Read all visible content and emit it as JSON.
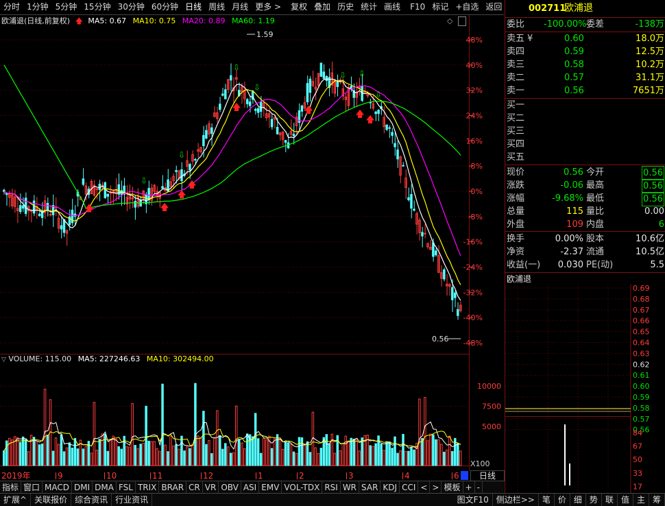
{
  "toolbar": {
    "items": [
      "分时",
      "1分钟",
      "5分钟",
      "15分钟",
      "30分钟",
      "60分钟",
      "日线",
      "周线",
      "月线",
      "更多 >",
      "复权",
      "叠加",
      "历史",
      "统计",
      "画线",
      "F10",
      "标记",
      "+自选",
      "返回"
    ],
    "active": "日线"
  },
  "legend": {
    "title": "欧浦退(日线,前复权)",
    "ma5": "MA5: 0.67",
    "ma10": "MA10: 0.75",
    "ma20": "MA20: 0.89",
    "ma60": "MA60: 1.19",
    "colors": {
      "ma5": "#ffffff",
      "ma10": "#ffff00",
      "ma20": "#ff00ff",
      "ma60": "#00ff00"
    }
  },
  "price_axis": [
    "48%",
    "40%",
    "32%",
    "24%",
    "16%",
    "8%",
    "0%",
    "-8%",
    "-16%",
    "-24%",
    "-32%",
    "-40%",
    "-48%"
  ],
  "annotations": {
    "high": "1.59",
    "low_marker": "0.56"
  },
  "volume": {
    "legend_vol": "VOLUME: 115.00",
    "legend_ma5": "MA5: 227246.63",
    "legend_ma10": "MA10: 302494.00",
    "axis": [
      "10000",
      "7500",
      "5000"
    ],
    "unit": "X100"
  },
  "dates": [
    "2019年",
    "9",
    "10",
    "11",
    "12",
    "1",
    "2",
    "3",
    "4",
    "6"
  ],
  "side_period_btn": "日线",
  "chart_data": {
    "type": "candlestick",
    "title": "欧浦退(日线,前复权)",
    "series_names": [
      "MA5",
      "MA10",
      "MA20",
      "MA60"
    ],
    "y_axis_labels": [
      "48%",
      "40%",
      "32%",
      "24%",
      "16%",
      "8%",
      "0%",
      "-8%",
      "-16%",
      "-24%",
      "-32%",
      "-40%",
      "-48%"
    ],
    "ylim_pct": [
      -52,
      52
    ],
    "annotated_high": 1.59,
    "last_close": 0.56,
    "ma_values_latest": {
      "MA5": 0.67,
      "MA10": 0.75,
      "MA20": 0.89,
      "MA60": 1.19
    },
    "volume_axis": [
      10000,
      7500,
      5000
    ],
    "volume_latest": 115.0,
    "volume_ma5": 227246.63,
    "volume_ma10": 302494.0
  },
  "quote": {
    "code": "002711",
    "name": "欧浦退",
    "weibi_label": "委比",
    "weibi": "-100.00%",
    "weicha_label": "委差",
    "weicha": "-138万",
    "asks": [
      {
        "label": "卖五",
        "mark": "¥",
        "price": "0.60",
        "vol": "18.0万"
      },
      {
        "label": "卖四",
        "mark": "",
        "price": "0.59",
        "vol": "12.5万"
      },
      {
        "label": "卖三",
        "mark": "",
        "price": "0.58",
        "vol": "10.2万"
      },
      {
        "label": "卖二",
        "mark": "",
        "price": "0.57",
        "vol": "31.1万"
      },
      {
        "label": "卖一",
        "mark": "",
        "price": "0.56",
        "vol": "7651万"
      }
    ],
    "bids": [
      {
        "label": "买一"
      },
      {
        "label": "买二"
      },
      {
        "label": "买三"
      },
      {
        "label": "买四"
      },
      {
        "label": "买五"
      }
    ],
    "stats": [
      {
        "l1": "现价",
        "v1": "0.56",
        "l2": "今开",
        "v2": "0.56"
      },
      {
        "l1": "涨跌",
        "v1": "-0.06",
        "l2": "最高",
        "v2": "0.56"
      },
      {
        "l1": "涨幅",
        "v1": "-9.68%",
        "l2": "最低",
        "v2": "0.56"
      },
      {
        "l1": "总量",
        "v1": "115",
        "l2": "量比",
        "v2": "0.00"
      },
      {
        "l1": "外盘",
        "v1": "109",
        "l2": "内盘",
        "v2": "6"
      }
    ],
    "fund": [
      {
        "l1": "换手",
        "v1": "0.00%",
        "l2": "股本",
        "v2": "10.6亿"
      },
      {
        "l1": "净资",
        "v1": "-2.37",
        "l2": "流通",
        "v2": "10.5亿"
      },
      {
        "l1": "收益(一)",
        "v1": "0.030",
        "l2": "PE(动)",
        "v2": "5.5"
      }
    ]
  },
  "mini": {
    "title": "欧浦退",
    "price_axis": [
      "0.69",
      "0.68",
      "0.67",
      "0.66",
      "0.65",
      "0.64",
      "0.63",
      "0.62",
      "0.61",
      "0.60",
      "0.59",
      "0.58",
      "0.57",
      "0.56"
    ],
    "vol_axis": [
      "84",
      "67",
      "50",
      "33",
      "17"
    ]
  },
  "indicators": [
    "指标",
    "窗口",
    "MACD",
    "DMI",
    "DMA",
    "FSL",
    "TRIX",
    "BRAR",
    "CR",
    "VR",
    "OBV",
    "ASI",
    "EMV",
    "VOL-TDX",
    "RSI",
    "WR",
    "SAR",
    "KDJ",
    "CCI",
    "<",
    ">",
    "模板",
    "+",
    "-"
  ],
  "extbar": [
    "扩展^",
    "关联报价",
    "综合资讯",
    "行业资讯",
    "图文F10",
    "侧边栏>>",
    "笔",
    "价",
    "细",
    "势",
    "联",
    "值",
    "主",
    "筹"
  ]
}
